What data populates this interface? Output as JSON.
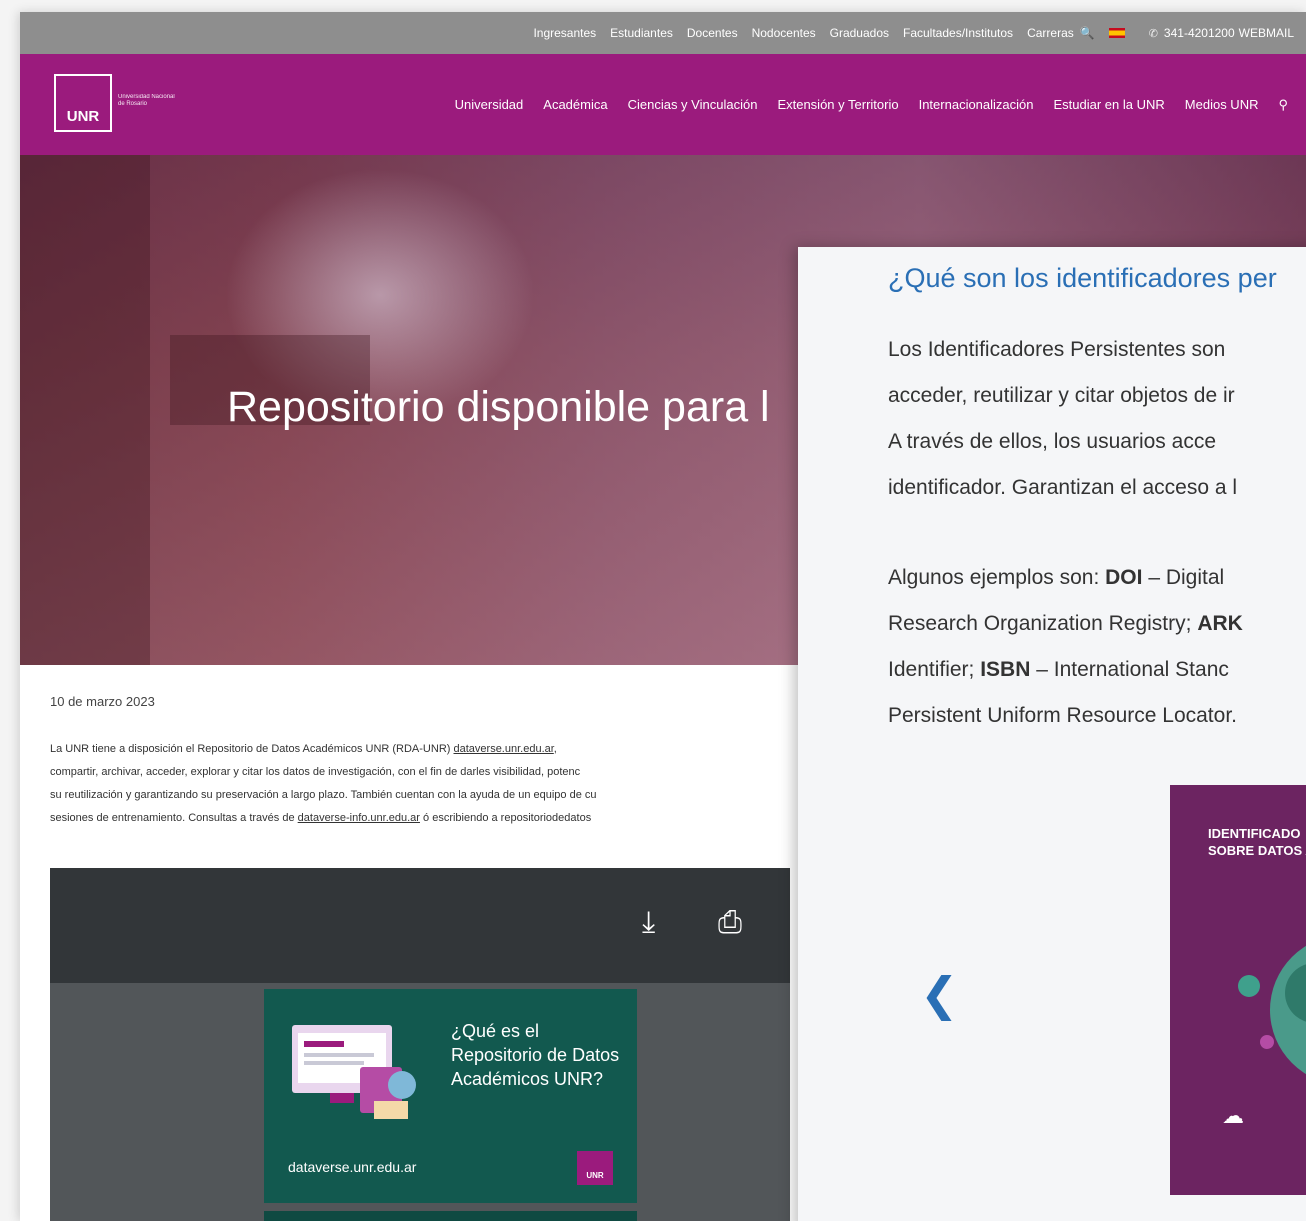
{
  "topbar": {
    "links": [
      "Ingresantes",
      "Estudiantes",
      "Docentes",
      "Nodocentes",
      "Graduados",
      "Facultades/Institutos",
      "Carreras"
    ],
    "phone": "341-4201200",
    "webmail": "WEBMAIL"
  },
  "header": {
    "logo_text": "UNR",
    "logo_sub": "Universidad Nacional de Rosario",
    "nav": [
      "Universidad",
      "Académica",
      "Ciencias y Vinculación",
      "Extensión y Territorio",
      "Internacionalización",
      "Estudiar en la UNR",
      "Medios UNR"
    ]
  },
  "hero": {
    "title": "Repositorio disponible para l"
  },
  "article": {
    "date": "10 de marzo 2023",
    "lines": [
      [
        "La UNR tiene a disposición el Repositorio de Datos Académicos UNR (RDA-UNR)",
        "dataverse.unr.edu.ar",
        ","
      ],
      [
        "compartir, archivar, acceder, explorar y citar los datos de investigación, con el fin de darles visibilidad, potenc",
        "",
        ""
      ],
      [
        "su reutilización y garantizando su preservación a largo plazo. También cuentan con la ayuda de un equipo de cu",
        "",
        ""
      ],
      [
        "sesiones de entrenamiento. Consultas a través de ",
        "dataverse-info.unr.edu.ar",
        " ó escribiendo a repositoriodedatos"
      ]
    ]
  },
  "viewer": {
    "pdf_title": "¿Qué es el Repositorio de Datos Académicos UNR?",
    "pdf_url": "dataverse.unr.edu.ar",
    "pdf_badge": "UNR"
  },
  "overlay": {
    "title": "¿Qué son los identificadores per",
    "paragraph1": [
      "Los Identificadores Persistentes son",
      "acceder, reutilizar y citar objetos de ir",
      "A través de ellos, los usuarios acce",
      "identificador. Garantizan el acceso a l"
    ],
    "examples_intro": "Algunos ejemplos son: ",
    "doi": "DOI",
    "doi_rest": " – Digital",
    "line2_pre": "Research Organization Registry; ",
    "ark": "ARK",
    "line3_pre": "Identifier; ",
    "isbn": "ISBN",
    "isbn_rest": " – International Stanc",
    "line4": "Persistent Uniform Resource Locator.",
    "card_title_1": "IDENTIFICADO",
    "card_title_2": "SOBRE DATOS A"
  },
  "colors": {
    "topbar": "#8e8e8e",
    "brand": "#9b1b7d",
    "link_blue": "#2a6fb5",
    "pdf_green": "#12594f",
    "card_purple": "#6c2461"
  }
}
